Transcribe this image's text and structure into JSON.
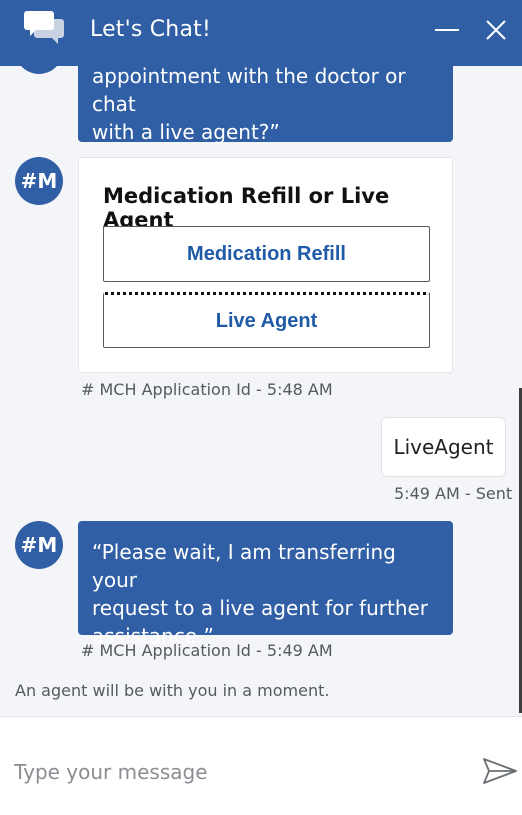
{
  "header": {
    "title": "Let's Chat!"
  },
  "messages": {
    "bot_prev_line1": "appointment with the doctor or chat",
    "bot_prev_line2": "with a live agent?”",
    "avatar_initials": "#M",
    "card_title": "Medication Refill or Live Agent",
    "option_1": "Medication Refill",
    "option_2": "Live Agent",
    "card_meta": "# MCH Application Id - 5:48 AM",
    "user_message": "LiveAgent",
    "user_meta": "5:49 AM - Sent",
    "bot_wait_line1": "“Please wait, I am transferring your",
    "bot_wait_line2": "request to a live agent for further",
    "bot_wait_line3": "assistance.”",
    "wait_meta": "# MCH Application Id - 5:49 AM"
  },
  "status_text": "An agent will be with you in a moment.",
  "composer": {
    "placeholder": "Type your message"
  },
  "colors": {
    "brand": "#315fa6",
    "option_text": "#1f5aa6",
    "background": "#f4f5f8"
  },
  "icons": {
    "chat": "chat-bubbles-icon",
    "minimize": "minimize-icon",
    "close": "close-icon",
    "send": "send-icon"
  }
}
